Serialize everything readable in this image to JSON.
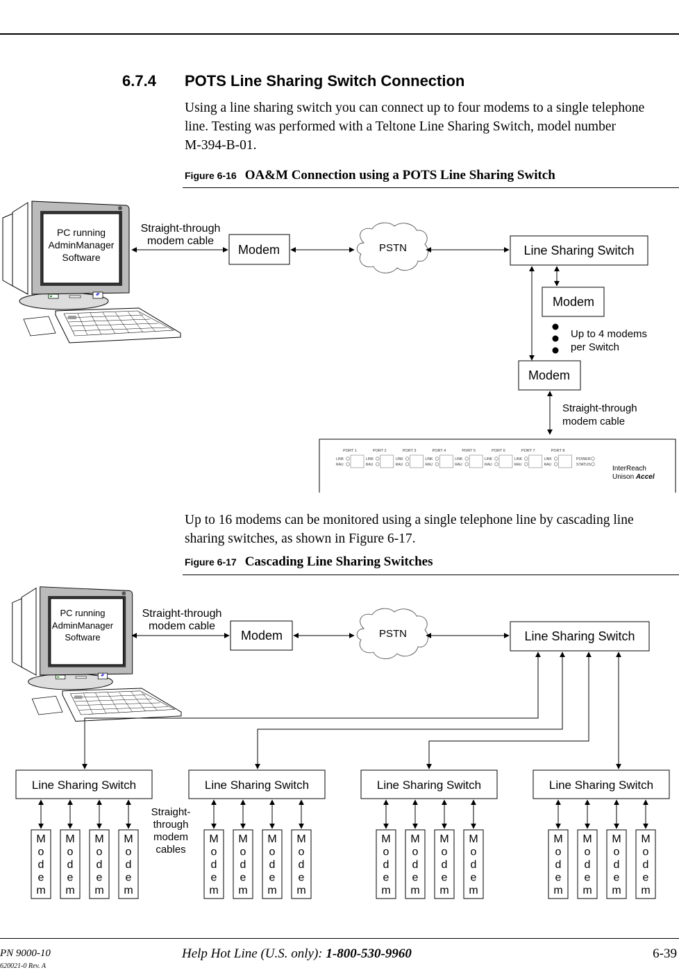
{
  "section": {
    "number": "6.7.4",
    "title": "POTS Line Sharing Switch Connection",
    "intro_lines": [
      "Using a line sharing switch you can connect up to four modems to a single telephone",
      "line. Testing was performed with a Teltone Line Sharing Switch, model number",
      "M-394-B-01."
    ]
  },
  "figure1": {
    "label": "Figure 6-16",
    "title": "OA&M Connection using a POTS Line Sharing Switch",
    "pc_label_lines": [
      "PC running",
      "AdminManager",
      "Software"
    ],
    "cable_label_lines": [
      "Straight-through",
      "modem cable"
    ],
    "modem_label": "Modem",
    "pstn_label": "PSTN",
    "switch_label": "Line Sharing Switch",
    "note_lines": [
      "Up to 4 modems",
      "per Switch"
    ],
    "cable2_label_lines": [
      "Straight-through",
      "modem cable"
    ],
    "device": {
      "ports": [
        "PORT 1",
        "PORT 2",
        "PORT 3",
        "PORT 4",
        "PORT 5",
        "PORT 6",
        "PORT 7",
        "PORT 8"
      ],
      "led_labels": [
        "LINK",
        "RAU"
      ],
      "status_leds": [
        "POWER",
        "STATUS"
      ],
      "brand_line1": "InterReach",
      "brand_line2_prefix": "Unison ",
      "brand_line2_emph": "Accel"
    }
  },
  "middle_text_lines": [
    "Up to 16 modems can be monitored using a single telephone line by cascading line",
    "sharing switches, as shown in Figure 6-17."
  ],
  "figure2": {
    "label": "Figure 6-17",
    "title": "Cascading Line Sharing Switches",
    "pc_label_lines": [
      "PC running",
      "AdminManager",
      "Software"
    ],
    "cable_label_lines": [
      "Straight-through",
      "modem cable"
    ],
    "modem_label": "Modem",
    "pstn_label": "PSTN",
    "switch_label": "Line Sharing Switch",
    "child_switch_label": "Line Sharing Switch",
    "child_switch_count": 4,
    "modems_per_switch": 4,
    "vertical_modem_letters": [
      "M",
      "o",
      "d",
      "e",
      "m"
    ],
    "cables_label_lines": [
      "Straight-",
      "through",
      "modem",
      "cables"
    ]
  },
  "footer": {
    "pn": "PN 9000-10",
    "rev": "620021-0 Rev. A",
    "hotline_prefix": "Help Hot Line (U.S. only): ",
    "hotline_number": "1-800-530-9960",
    "page": "6-39"
  }
}
